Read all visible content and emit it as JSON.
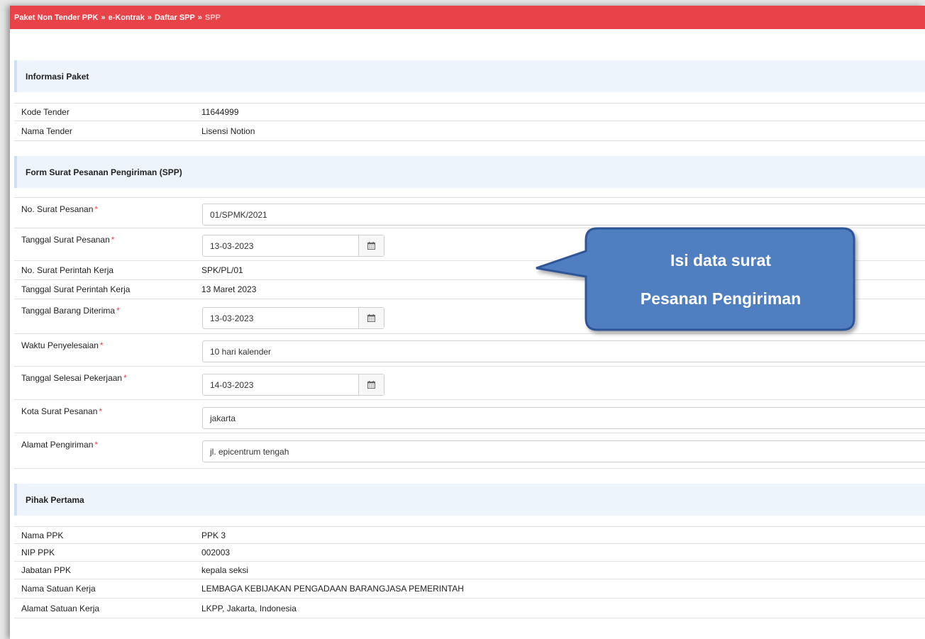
{
  "breadcrumb": {
    "items": [
      "Paket Non Tender PPK",
      "e-Kontrak",
      "Daftar SPP"
    ],
    "current": "SPP",
    "separator": "»"
  },
  "informasi_paket": {
    "title": "Informasi Paket",
    "rows": [
      {
        "label": "Kode Tender",
        "value": "11644999"
      },
      {
        "label": "Nama Tender",
        "value": "Lisensi Notion"
      }
    ]
  },
  "form_spp": {
    "title": "Form Surat Pesanan Pengiriman (SPP)",
    "required_mark": "*",
    "no_surat_pesanan": {
      "label": "No. Surat Pesanan",
      "value": "01/SPMK/2021"
    },
    "tanggal_surat_pesanan": {
      "label": "Tanggal Surat Pesanan",
      "value": "13-03-2023"
    },
    "no_spk": {
      "label": "No. Surat Perintah Kerja",
      "value": "SPK/PL/01"
    },
    "tanggal_spk": {
      "label": "Tanggal Surat Perintah Kerja",
      "value": "13 Maret 2023"
    },
    "tanggal_barang_diterima": {
      "label": "Tanggal Barang Diterima",
      "value": "13-03-2023"
    },
    "waktu_penyelesaian": {
      "label": "Waktu Penyelesaian",
      "value": "10 hari kalender"
    },
    "tanggal_selesai": {
      "label": "Tanggal Selesai Pekerjaan",
      "value": "14-03-2023"
    },
    "kota_surat_pesanan": {
      "label": "Kota Surat Pesanan",
      "value": "jakarta"
    },
    "alamat_pengiriman": {
      "label": "Alamat Pengiriman",
      "value": "jl. epicentrum tengah"
    }
  },
  "pihak_pertama": {
    "title": "Pihak Pertama",
    "rows": [
      {
        "label": "Nama PPK",
        "value": "PPK 3"
      },
      {
        "label": "NIP PPK",
        "value": "002003"
      },
      {
        "label": "Jabatan PPK",
        "value": "kepala seksi"
      },
      {
        "label": "Nama Satuan Kerja",
        "value": "LEMBAGA KEBIJAKAN PENGADAAN BARANGJASA PEMERINTAH"
      },
      {
        "label": "Alamat Satuan Kerja",
        "value": "LKPP, Jakarta, Indonesia"
      }
    ]
  },
  "callout": {
    "line1": "Isi data surat",
    "line2": "Pesanan Pengiriman"
  },
  "colors": {
    "header_bar": "#e9434a",
    "section_bg": "#eef4fb",
    "callout_fill": "#4f7fc0",
    "callout_border": "#2f5597"
  },
  "icons": {
    "date_picker": "calendar-icon"
  }
}
